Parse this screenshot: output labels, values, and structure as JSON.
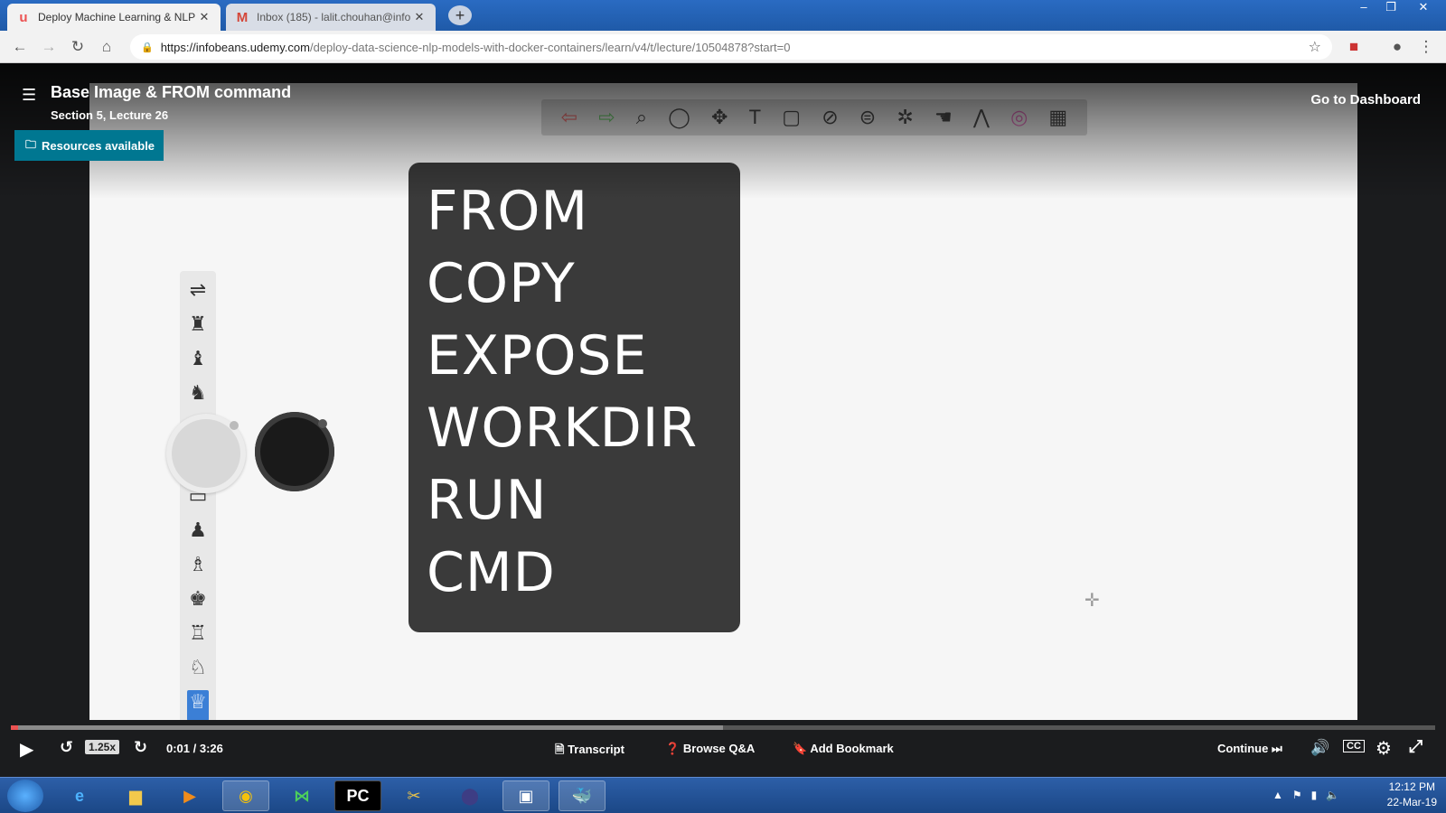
{
  "browser": {
    "tabs": [
      {
        "title": "Deploy Machine Learning & NLP",
        "icon": "udemy-icon",
        "active": true
      },
      {
        "title": "Inbox (185) - lalit.chouhan@info",
        "icon": "gmail-icon",
        "active": false
      }
    ],
    "new_tab_label": "+",
    "address": {
      "host": "https://infobeans.udemy.com",
      "path": "/deploy-data-science-nlp-models-with-docker-containers/learn/v4/t/lecture/10504878?start=0"
    }
  },
  "lecture": {
    "title": "Base Image & FROM command",
    "subtitle": "Section 5, Lecture 26",
    "resources_label": "Resources available",
    "dashboard_label": "Go to Dashboard"
  },
  "slide": {
    "commands": [
      "FROM",
      "COPY",
      "EXPOSE",
      "WORKDIR",
      "RUN",
      "CMD"
    ]
  },
  "player": {
    "speed": "1.25x",
    "time": "0:01 / 3:26",
    "played_fraction": 0.003,
    "buffered_fraction": 0.5,
    "transcript_label": "Transcript",
    "qa_label": "Browse Q&A",
    "bookmark_label": "Add Bookmark",
    "continue_label": "Continue",
    "cc_label": "CC"
  },
  "taskbar": {
    "time": "12:12 PM",
    "date": "22-Mar-19",
    "pycharm_label": "PC"
  },
  "colors": {
    "udemy_teal": "#007791",
    "progress_red": "#ec5252"
  }
}
